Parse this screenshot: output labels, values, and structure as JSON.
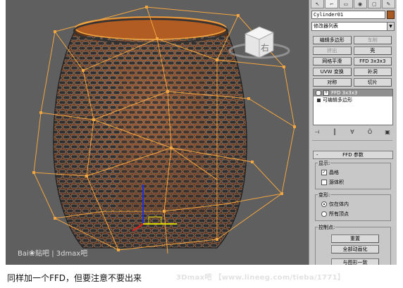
{
  "viewport": {
    "watermark": {
      "logo": "Bai",
      "paw": "❀",
      "tieba": "贴吧",
      "divider": "|",
      "site": "3dmax吧"
    },
    "viewcube_label": "右"
  },
  "command_panel": {
    "tabs": [
      "↖",
      "⌐",
      "▭",
      "◉",
      "▢",
      "✎"
    ],
    "object_name": "Cylinder01",
    "object_color": "#a85a25",
    "modifier_list": "修改器列表",
    "buttons": [
      {
        "label": "编辑多边形",
        "enabled": true
      },
      {
        "label": "车削",
        "enabled": false
      },
      {
        "label": "挤出",
        "enabled": false
      },
      {
        "label": "壳",
        "enabled": true
      },
      {
        "label": "网格平滑",
        "enabled": true
      },
      {
        "label": "FFD 3x3x3",
        "enabled": true
      },
      {
        "label": "UVW 变换",
        "enabled": true
      },
      {
        "label": "补洞",
        "enabled": true
      },
      {
        "label": "对称",
        "enabled": true
      },
      {
        "label": "切片",
        "enabled": true
      }
    ],
    "stack": [
      {
        "label": "FFD 3x3x3",
        "selected": true
      },
      {
        "label": "可编辑多边形",
        "selected": false
      }
    ],
    "stack_tools": [
      "⊣",
      "║",
      "∀",
      "Ö",
      "▣"
    ],
    "rollout": {
      "minus": "-",
      "title": "FFD 参数",
      "display_group": "显示:",
      "lattice": {
        "label": "晶格",
        "checked": true
      },
      "source_volume": {
        "label": "源体积",
        "checked": false
      },
      "deform_group": "变形:",
      "only_in_volume": {
        "label": "仅在体内",
        "selected": true
      },
      "all_vertices": {
        "label": "所有顶点",
        "selected": false
      },
      "control_points_group": "控制点:",
      "reset_button": "重置",
      "animate_all_button": "全部动画化",
      "conform_button": "与图形一致"
    }
  },
  "caption": "同样加一个FFD，但要注意不要出来",
  "site_watermark": "3Dmax吧 【www.lineeg.com/tieba/1771】",
  "colors": {
    "viewport_bg": "#5f5f5f",
    "lattice": "#f3a640",
    "mesh_dark": "#2e2e2e",
    "mesh_light": "#bfbfbf",
    "interior": "#8c4a22",
    "top_cap": "#b05c22"
  }
}
